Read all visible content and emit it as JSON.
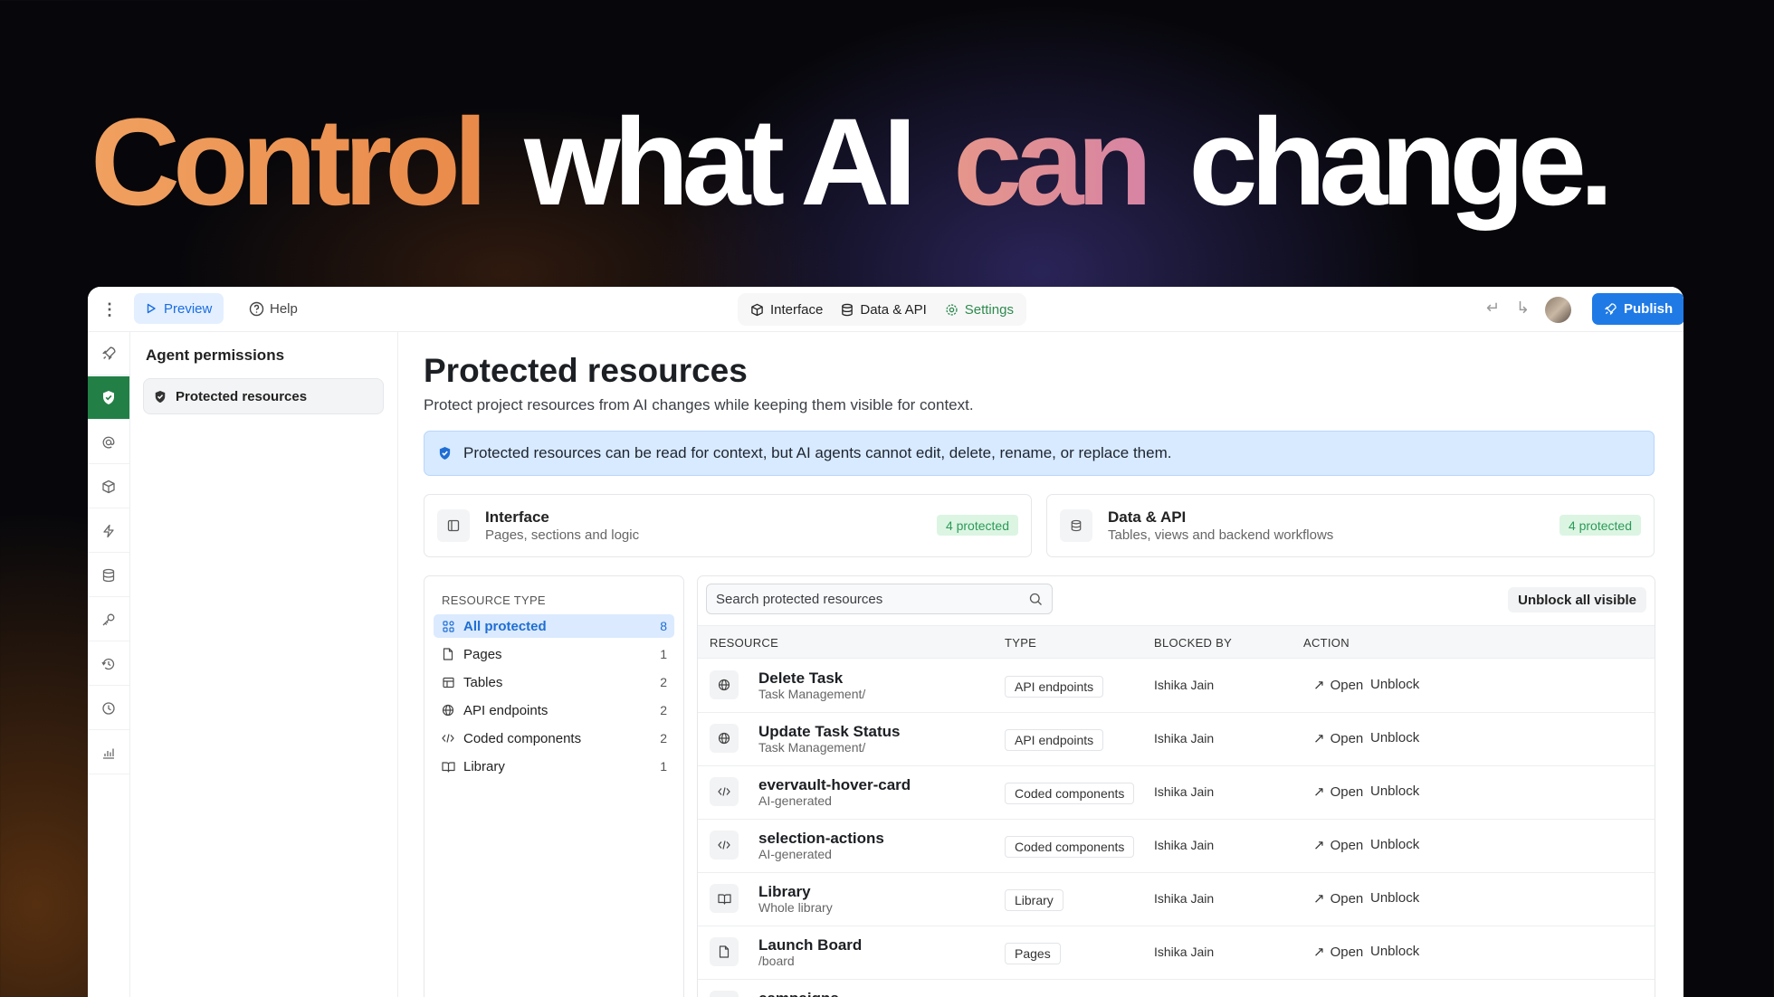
{
  "headline": {
    "word1": "Control",
    "word2": "what AI",
    "word3": "can",
    "word4": "change."
  },
  "topbar": {
    "preview_label": "Preview",
    "help_label": "Help",
    "tabs": [
      {
        "label": "Interface",
        "icon": "cube-icon"
      },
      {
        "label": "Data & API",
        "icon": "database-icon"
      },
      {
        "label": "Settings",
        "icon": "gear-icon"
      }
    ],
    "publish_label": "Publish"
  },
  "rail": [
    "rocket-icon",
    "shield-icon",
    "at-icon",
    "cube-icon",
    "bolt-icon",
    "database-icon",
    "key-icon",
    "history-icon",
    "clock-icon",
    "analytics-icon"
  ],
  "subnav": {
    "title": "Agent permissions",
    "item_label": "Protected resources"
  },
  "main": {
    "title": "Protected resources",
    "subtitle": "Protect project resources from AI changes while keeping them visible for context.",
    "banner": "Protected resources can be read for context, but AI agents cannot edit, delete, rename, or replace them.",
    "cards": [
      {
        "title": "Interface",
        "sub": "Pages, sections and logic",
        "badge": "4 protected"
      },
      {
        "title": "Data & API",
        "sub": "Tables, views and backend workflows",
        "badge": "4 protected"
      }
    ]
  },
  "filter": {
    "heading": "RESOURCE TYPE",
    "items": [
      {
        "label": "All protected",
        "count": "8"
      },
      {
        "label": "Pages",
        "count": "1"
      },
      {
        "label": "Tables",
        "count": "2"
      },
      {
        "label": "API endpoints",
        "count": "2"
      },
      {
        "label": "Coded components",
        "count": "2"
      },
      {
        "label": "Library",
        "count": "1"
      }
    ]
  },
  "table": {
    "search_placeholder": "Search protected resources",
    "unblock_all_label": "Unblock all visible",
    "headers": {
      "resource": "RESOURCE",
      "type": "TYPE",
      "blocked_by": "BLOCKED BY",
      "action": "ACTION"
    },
    "open_label": "Open",
    "unblock_label": "Unblock",
    "rows": [
      {
        "name": "Delete Task",
        "path": "Task Management/",
        "type": "API endpoints",
        "blocked_by": "Ishika Jain",
        "icon": "globe-icon"
      },
      {
        "name": "Update Task Status",
        "path": "Task Management/",
        "type": "API endpoints",
        "blocked_by": "Ishika Jain",
        "icon": "globe-icon"
      },
      {
        "name": "evervault-hover-card",
        "path": "AI-generated",
        "type": "Coded components",
        "blocked_by": "Ishika Jain",
        "icon": "code-icon"
      },
      {
        "name": "selection-actions",
        "path": "AI-generated",
        "type": "Coded components",
        "blocked_by": "Ishika Jain",
        "icon": "code-icon"
      },
      {
        "name": "Library",
        "path": "Whole library",
        "type": "Library",
        "blocked_by": "Ishika Jain",
        "icon": "book-icon"
      },
      {
        "name": "Launch Board",
        "path": "/board",
        "type": "Pages",
        "blocked_by": "Ishika Jain",
        "icon": "page-icon"
      },
      {
        "name": "campaigns",
        "path": "",
        "type": "",
        "blocked_by": "",
        "icon": "table-icon"
      }
    ]
  },
  "colors": {
    "accent": "#1f7ae6",
    "green": "#228046",
    "badge_green": "#2c9a57",
    "banner_bg": "#d8eaff"
  }
}
